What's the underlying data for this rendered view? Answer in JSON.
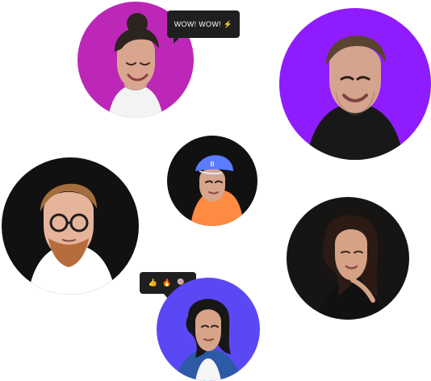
{
  "profiles": [
    {
      "label": "profile-1",
      "background": "#bc27b7",
      "shirt": "#f3f3f3",
      "hair": "#2c241f",
      "skin": "#d9a58e"
    },
    {
      "label": "profile-2",
      "background": "#8f1cff",
      "shirt": "#181818",
      "hair": "#5b4331",
      "skin": "#d5a48f"
    },
    {
      "label": "profile-3",
      "background": "#111111",
      "shirt": "#ff8a42",
      "hair": "#1f1f1f",
      "skin": "#d7a48c",
      "cap": "#5b7cff"
    },
    {
      "label": "profile-4",
      "background": "#111111",
      "shirt": "#ffffff",
      "hair": "#a56d3d",
      "skin": "#e6b49b",
      "beard": "#b66d3b"
    },
    {
      "label": "profile-5",
      "background": "#171414",
      "shirt": "#111111",
      "hair": "#2b1b14",
      "skin": "#d6a285"
    },
    {
      "label": "profile-6",
      "background": "#5b48f5",
      "shirt": "#2d5aa6",
      "hair": "#171717",
      "skin": "#d7a48a"
    }
  ],
  "bubbles": {
    "wow_text": "WOW! WOW! ⚡",
    "emoji_text": "👍 🔥 🍭"
  }
}
